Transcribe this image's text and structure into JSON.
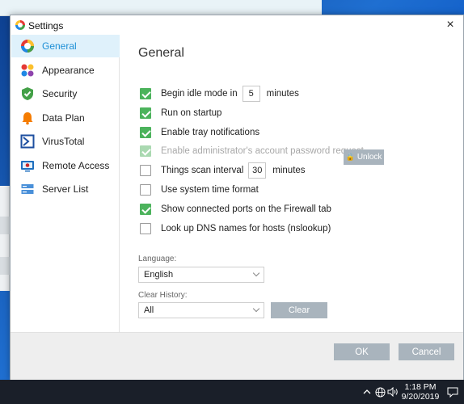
{
  "window": {
    "title": "Settings",
    "close_glyph": "×"
  },
  "sidebar": {
    "items": [
      {
        "label": "General",
        "icon": "general-icon",
        "active": true
      },
      {
        "label": "Appearance",
        "icon": "palette-icon",
        "active": false
      },
      {
        "label": "Security",
        "icon": "shield-icon",
        "active": false
      },
      {
        "label": "Data Plan",
        "icon": "bell-icon",
        "active": false
      },
      {
        "label": "VirusTotal",
        "icon": "virustotal-icon",
        "active": false
      },
      {
        "label": "Remote Access",
        "icon": "remote-access-icon",
        "active": false
      },
      {
        "label": "Server List",
        "icon": "server-icon",
        "active": false
      }
    ]
  },
  "general": {
    "heading": "General",
    "options": [
      {
        "label": "Begin idle mode in",
        "checked": true,
        "value": "5",
        "suffix": "minutes"
      },
      {
        "label": "Run on startup",
        "checked": true
      },
      {
        "label": "Enable tray notifications",
        "checked": true
      },
      {
        "label": "Enable administrator's account password request",
        "checked": true,
        "disabled": true
      },
      {
        "label": "Things scan interval",
        "checked": false,
        "value": "30",
        "suffix": "minutes"
      },
      {
        "label": "Use system time format",
        "checked": false
      },
      {
        "label": "Show connected ports on the Firewall tab",
        "checked": true
      },
      {
        "label": "Look up DNS names for hosts (nslookup)",
        "checked": false
      }
    ],
    "unlock_label": "Unlock",
    "language": {
      "label": "Language:",
      "value": "English"
    },
    "clear_history": {
      "label": "Clear History:",
      "value": "All",
      "button": "Clear"
    }
  },
  "footer": {
    "ok_label": "OK",
    "cancel_label": "Cancel"
  },
  "taskbar": {
    "time": "1:18 PM",
    "date": "9/20/2019"
  },
  "colors": {
    "accent": "#1d8fd6",
    "check_green": "#4cb35c",
    "button_gray": "#a9b4bd"
  }
}
